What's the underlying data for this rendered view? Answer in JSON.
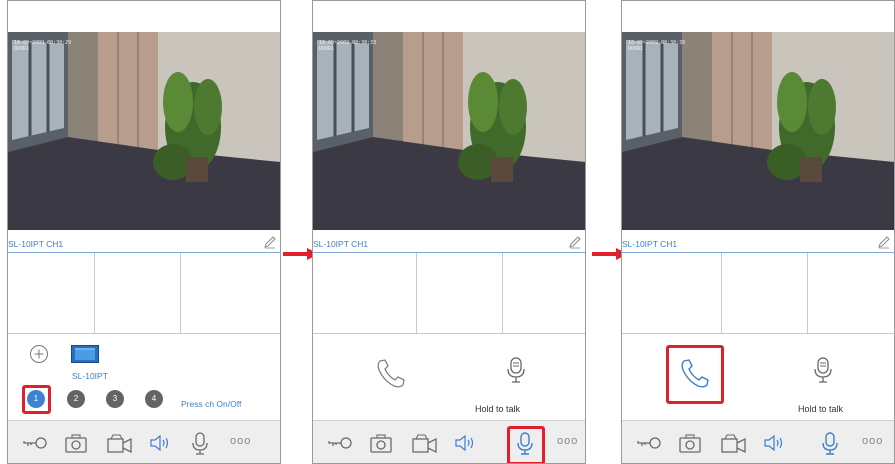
{
  "screens": [
    {
      "timestamp": "10-05-2009 00:38:29\nDOOR1",
      "channel_label": "SL-10IPT CH1"
    },
    {
      "timestamp": "10-05-2009 00:38:33\nDOOR1",
      "channel_label": "SL-10IPT CH1"
    },
    {
      "timestamp": "10-05-2009 00:38:39\nDOOR1",
      "channel_label": "SL-10IPT CH1"
    }
  ],
  "screen1": {
    "device_label": "SL-10IPT",
    "channels": [
      "1",
      "2",
      "3",
      "4"
    ],
    "selected_channel": "1",
    "press_hint": "Press ch On/Off"
  },
  "call_panel": {
    "hold_to_talk": "Hold to talk"
  },
  "toolbar_icons": [
    "key-icon",
    "camera-icon",
    "video-record-icon",
    "speaker-icon",
    "microphone-icon",
    "more-icon"
  ],
  "more_label": "ooo",
  "colors": {
    "accent": "#3c7fd0",
    "highlight": "#e0202a",
    "channel_selected": "#3b84d4",
    "channel": "#646464"
  }
}
